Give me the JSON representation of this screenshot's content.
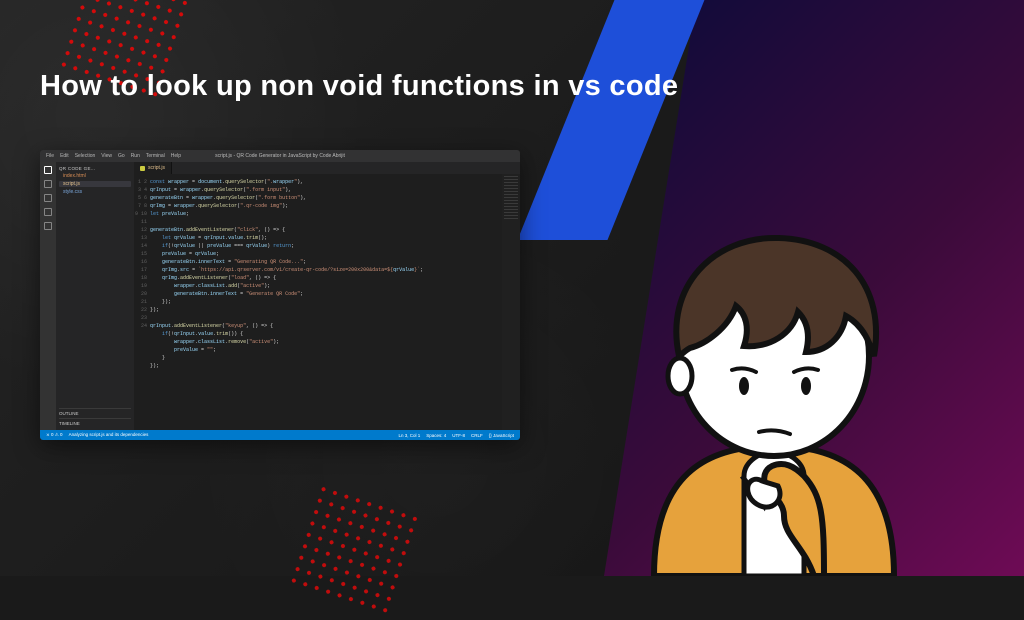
{
  "title": "How to look up non void functions in vs code",
  "vscode": {
    "menu": [
      "File",
      "Edit",
      "Selection",
      "View",
      "Go",
      "Run",
      "Terminal",
      "Help"
    ],
    "window_title": "script.js - QR Code Generator in JavaScript by Code Abrijit",
    "sidebar": {
      "header": "QR CODE GE...",
      "items": [
        {
          "label": "index.html",
          "cls": "html"
        },
        {
          "label": "script.js",
          "cls": "js active"
        },
        {
          "label": "style.css",
          "cls": "css"
        }
      ],
      "sections": [
        "OUTLINE",
        "TIMELINE"
      ]
    },
    "tabs": [
      {
        "label": "script.js"
      }
    ],
    "code_lines": [
      "const wrapper = document.querySelector(\".wrapper\"),",
      "qrInput = wrapper.querySelector(\".form input\"),",
      "generateBtn = wrapper.querySelector(\".form button\"),",
      "qrImg = wrapper.querySelector(\".qr-code img\");",
      "let preValue;",
      "",
      "generateBtn.addEventListener(\"click\", () => {",
      "    let qrValue = qrInput.value.trim();",
      "    if(!qrValue || preValue === qrValue) return;",
      "    preValue = qrValue;",
      "    generateBtn.innerText = \"Generating QR Code...\";",
      "    qrImg.src = `https://api.qrserver.com/v1/create-qr-code/?size=200x200&data=${qrValue}`;",
      "    qrImg.addEventListener(\"load\", () => {",
      "        wrapper.classList.add(\"active\");",
      "        generateBtn.innerText = \"Generate QR Code\";",
      "    });",
      "});",
      "",
      "qrInput.addEventListener(\"keyup\", () => {",
      "    if(!qrInput.value.trim()) {",
      "        wrapper.classList.remove(\"active\");",
      "        preValue = \"\";",
      "    }",
      "});"
    ],
    "status": {
      "left": [
        "⨯ 0 ⚠ 0",
        "Analyzing script.js and its dependencies"
      ],
      "right": [
        "Ln 3, Col 1",
        "Spaces: 4",
        "UTF-8",
        "CRLF",
        "{} JavaScript"
      ]
    }
  }
}
